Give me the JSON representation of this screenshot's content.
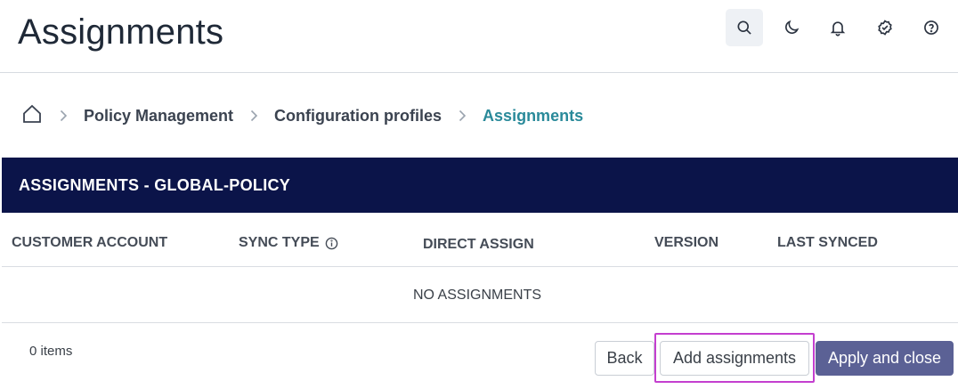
{
  "header": {
    "title": "Assignments",
    "icons": [
      "search-icon",
      "moon-icon",
      "bell-icon",
      "badge-check-icon",
      "help-icon"
    ]
  },
  "breadcrumb": {
    "home_icon": "home-icon",
    "items": [
      "Policy Management",
      "Configuration profiles",
      "Assignments"
    ]
  },
  "panel": {
    "title": "ASSIGNMENTS - GLOBAL-POLICY"
  },
  "table": {
    "columns": [
      "CUSTOMER ACCOUNT",
      "SYNC TYPE",
      "DIRECT ASSIGN",
      "VERSION",
      "LAST SYNCED"
    ],
    "empty_text": "NO ASSIGNMENTS"
  },
  "footer": {
    "items_count": "0 items",
    "back_label": "Back",
    "add_label": "Add assignments",
    "apply_label": "Apply and close"
  },
  "colors": {
    "panel_header": "#0b1449",
    "breadcrumb_current": "#2a8a9a",
    "primary_button": "#5b6195",
    "highlight": "#c43fcf"
  }
}
